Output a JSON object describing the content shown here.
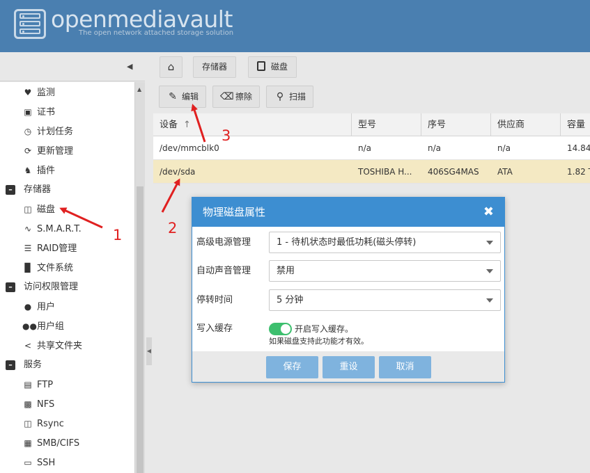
{
  "header": {
    "brand": "openmediavault",
    "tagline": "The open network attached storage solution"
  },
  "sidebar": {
    "items": [
      {
        "label": "监测",
        "icon": "heartbeat-icon",
        "kind": "leaf"
      },
      {
        "label": "证书",
        "icon": "certificate-icon",
        "kind": "leaf"
      },
      {
        "label": "计划任务",
        "icon": "calendar-clock-icon",
        "kind": "leaf"
      },
      {
        "label": "更新管理",
        "icon": "refresh-icon",
        "kind": "leaf"
      },
      {
        "label": "插件",
        "icon": "puzzle-icon",
        "kind": "leaf"
      },
      {
        "label": "存储器",
        "icon": "minus-square-icon",
        "kind": "group"
      },
      {
        "label": "磁盘",
        "icon": "hard-disk-icon",
        "kind": "leaf"
      },
      {
        "label": "S.M.A.R.T.",
        "icon": "pulse-icon",
        "kind": "leaf"
      },
      {
        "label": "RAID管理",
        "icon": "database-icon",
        "kind": "leaf"
      },
      {
        "label": "文件系统",
        "icon": "folder-icon",
        "kind": "leaf"
      },
      {
        "label": "访问权限管理",
        "icon": "minus-square-icon",
        "kind": "group"
      },
      {
        "label": "用户",
        "icon": "user-icon",
        "kind": "leaf"
      },
      {
        "label": "用户组",
        "icon": "users-icon",
        "kind": "leaf"
      },
      {
        "label": "共享文件夹",
        "icon": "share-icon",
        "kind": "leaf"
      },
      {
        "label": "服务",
        "icon": "minus-square-icon",
        "kind": "group"
      },
      {
        "label": "FTP",
        "icon": "server-icon",
        "kind": "leaf"
      },
      {
        "label": "NFS",
        "icon": "network-icon",
        "kind": "leaf"
      },
      {
        "label": "Rsync",
        "icon": "sync-icon",
        "kind": "leaf"
      },
      {
        "label": "SMB/CIFS",
        "icon": "windows-icon",
        "kind": "leaf"
      },
      {
        "label": "SSH",
        "icon": "terminal-icon",
        "kind": "leaf"
      }
    ]
  },
  "breadcrumb": {
    "storage": "存储器",
    "disk": "磁盘"
  },
  "toolbar": {
    "edit": "编辑",
    "wipe": "擦除",
    "scan": "扫描"
  },
  "table": {
    "columns": [
      "设备",
      "型号",
      "序号",
      "供应商",
      "容量"
    ],
    "rows": [
      [
        "/dev/mmcblk0",
        "n/a",
        "n/a",
        "n/a",
        "14.84"
      ],
      [
        "/dev/sda",
        "TOSHIBA H...",
        "406SG4MAS",
        "ATA",
        "1.82 T"
      ]
    ]
  },
  "dialog": {
    "title": "物理磁盘属性",
    "fields": {
      "apm_label": "高级电源管理",
      "apm_value": "1 - 待机状态时最低功耗(磁头停转)",
      "aam_label": "自动声音管理",
      "aam_value": "禁用",
      "spindown_label": "停转时间",
      "spindown_value": "5 分钟",
      "cache_label": "写入缓存",
      "cache_toggle_label": "开启写入缓存。",
      "cache_hint": "如果磁盘支持此功能才有效。"
    },
    "buttons": {
      "save": "保存",
      "reset": "重设",
      "cancel": "取消"
    }
  },
  "annotations": {
    "step1": "1",
    "step2": "2",
    "step3": "3",
    "color": "#e02020"
  },
  "colors": {
    "header": "#4a7fb0",
    "dialog_accent": "#3d8ed1",
    "selected_row": "#f4e9c3",
    "toggle_on": "#3dbf6e"
  }
}
